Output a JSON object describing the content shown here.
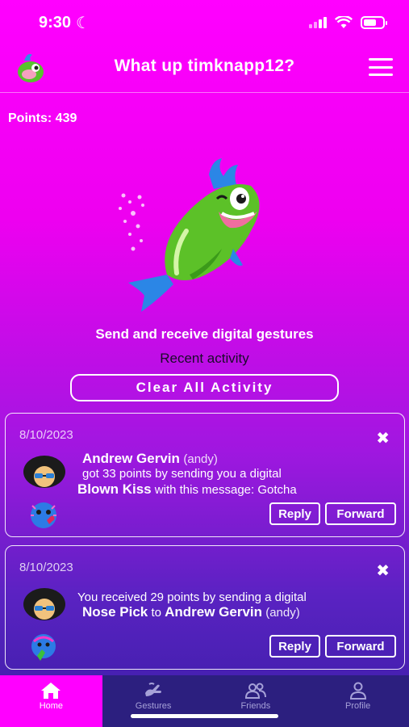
{
  "status_bar": {
    "time": "9:30"
  },
  "header": {
    "title": "What up timknapp12?"
  },
  "points": "Points: 439",
  "tagline": "Send and receive digital gestures",
  "recent_label": "Recent activity",
  "clear_button": "Clear All Activity",
  "activities": [
    {
      "date": "8/10/2023",
      "sender_name": "Andrew Gervin",
      "sender_handle": "(andy)",
      "line2": "got 33 points by sending you a digital",
      "gesture": "Blown Kiss",
      "message": "with this message: Gotcha",
      "reply": "Reply",
      "forward": "Forward"
    },
    {
      "date": "8/10/2023",
      "line1": "You received 29 points by sending a digital",
      "gesture": "Nose Pick",
      "to": "to",
      "recipient_name": "Andrew Gervin",
      "recipient_handle": "(andy)",
      "reply": "Reply",
      "forward": "Forward"
    }
  ],
  "tabs": [
    {
      "label": "Home",
      "icon": "home-icon",
      "active": true
    },
    {
      "label": "Gestures",
      "icon": "gestures-icon"
    },
    {
      "label": "Friends",
      "icon": "friends-icon"
    },
    {
      "label": "Profile",
      "icon": "profile-icon"
    }
  ],
  "colors": {
    "accent": "#ff00ff",
    "tab_bar": "#2c1f7f"
  }
}
